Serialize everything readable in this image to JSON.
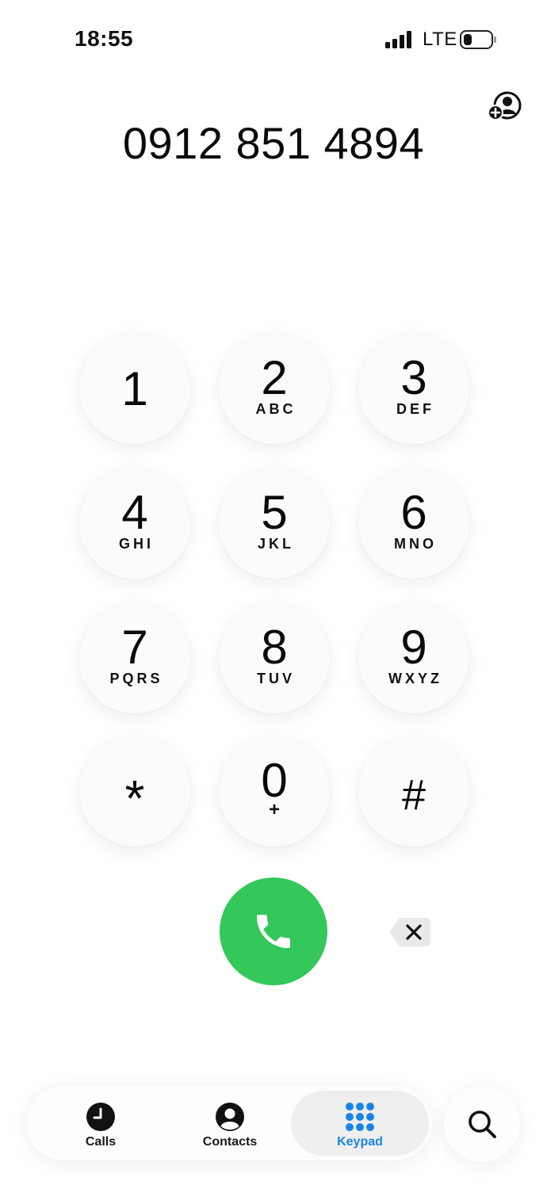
{
  "status_bar": {
    "time": "18:55",
    "network": "LTE"
  },
  "dialer": {
    "number": "0912 851 4894",
    "add_contact_icon": "person-add-icon"
  },
  "keypad": [
    {
      "digit": "1",
      "letters": ""
    },
    {
      "digit": "2",
      "letters": "ABC"
    },
    {
      "digit": "3",
      "letters": "DEF"
    },
    {
      "digit": "4",
      "letters": "GHI"
    },
    {
      "digit": "5",
      "letters": "JKL"
    },
    {
      "digit": "6",
      "letters": "MNO"
    },
    {
      "digit": "7",
      "letters": "PQRS"
    },
    {
      "digit": "8",
      "letters": "TUV"
    },
    {
      "digit": "9",
      "letters": "WXYZ"
    },
    {
      "digit": "*",
      "letters": ""
    },
    {
      "digit": "0",
      "letters": "+"
    },
    {
      "digit": "#",
      "letters": ""
    }
  ],
  "actions": {
    "call_icon": "phone-icon",
    "delete_icon": "backspace-icon"
  },
  "tabs": [
    {
      "label": "Calls",
      "icon": "clock-icon",
      "active": false
    },
    {
      "label": "Contacts",
      "icon": "person-icon",
      "active": false
    },
    {
      "label": "Keypad",
      "icon": "keypad-icon",
      "active": true
    }
  ],
  "search_icon": "search-icon",
  "colors": {
    "call_green": "#34c759",
    "active_tab_blue": "#1a84e6",
    "key_background": "#fbfbfb"
  }
}
